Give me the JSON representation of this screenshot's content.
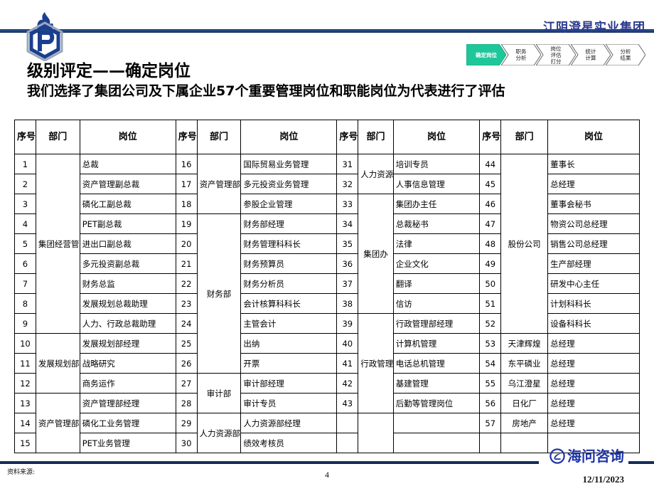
{
  "header": {
    "company_name": "江阴澄星实业集团",
    "logo_icon": "hexagon-flame-p-logo"
  },
  "process_steps": [
    {
      "label1": "确定岗位",
      "label2": "",
      "active": true
    },
    {
      "label1": "职务",
      "label2": "分析",
      "active": false
    },
    {
      "label1": "岗位",
      "label2": "评估",
      "label3": "打分",
      "active": false
    },
    {
      "label1": "统计",
      "label2": "计算",
      "active": false
    },
    {
      "label1": "分析",
      "label2": "结果",
      "active": false
    }
  ],
  "title": {
    "main": "级别评定——确定岗位",
    "sub": "我们选择了集团公司及下属企业57个重要管理岗位和职能岗位为代表进行了评估"
  },
  "table": {
    "headers": [
      "序号",
      "部门",
      "岗位",
      "序号",
      "部门",
      "岗位",
      "序号",
      "部门",
      "岗位",
      "序号",
      "部门",
      "岗位"
    ],
    "blocks": [
      {
        "departments": [
          {
            "name": "集团经营管理委员会",
            "rows": 9,
            "start": 0
          },
          {
            "name": "发展规划部",
            "rows": 3,
            "start": 9
          },
          {
            "name": "资产管理部",
            "rows": 3,
            "start": 12
          }
        ],
        "rows": [
          {
            "no": "1",
            "pos": "总裁"
          },
          {
            "no": "2",
            "pos": "资产管理副总裁"
          },
          {
            "no": "3",
            "pos": "磷化工副总裁"
          },
          {
            "no": "4",
            "pos": "PET副总裁"
          },
          {
            "no": "5",
            "pos": "进出口副总裁"
          },
          {
            "no": "6",
            "pos": "多元投资副总裁"
          },
          {
            "no": "7",
            "pos": "财务总监"
          },
          {
            "no": "8",
            "pos": "发展规划总裁助理"
          },
          {
            "no": "9",
            "pos": "人力、行政总裁助理"
          },
          {
            "no": "10",
            "pos": "发展规划部经理"
          },
          {
            "no": "11",
            "pos": "战略研究"
          },
          {
            "no": "12",
            "pos": "商务运作"
          },
          {
            "no": "13",
            "pos": "资产管理部经理"
          },
          {
            "no": "14",
            "pos": "磷化工业务管理"
          },
          {
            "no": "15",
            "pos": "PET业务管理"
          }
        ]
      },
      {
        "departments": [
          {
            "name": "资产管理部",
            "rows": 3,
            "start": 0
          },
          {
            "name": "财务部",
            "rows": 8,
            "start": 3
          },
          {
            "name": "审计部",
            "rows": 2,
            "start": 11
          },
          {
            "name": "人力资源部",
            "rows": 2,
            "start": 13
          }
        ],
        "rows": [
          {
            "no": "16",
            "pos": "国际贸易业务管理"
          },
          {
            "no": "17",
            "pos": "多元投资业务管理"
          },
          {
            "no": "18",
            "pos": "参股企业管理"
          },
          {
            "no": "19",
            "pos": "财务部经理"
          },
          {
            "no": "20",
            "pos": "财务管理科科长"
          },
          {
            "no": "21",
            "pos": "财务预算员"
          },
          {
            "no": "22",
            "pos": "财务分析员"
          },
          {
            "no": "23",
            "pos": "会计核算科科长"
          },
          {
            "no": "24",
            "pos": "主管会计"
          },
          {
            "no": "25",
            "pos": "出纳"
          },
          {
            "no": "26",
            "pos": "开票"
          },
          {
            "no": "27",
            "pos": "审计部经理"
          },
          {
            "no": "28",
            "pos": "审计专员"
          },
          {
            "no": "29",
            "pos": "人力资源部经理"
          },
          {
            "no": "30",
            "pos": "绩效考核员"
          }
        ]
      },
      {
        "departments": [
          {
            "name": "人力资源部",
            "rows": 2,
            "start": 0
          },
          {
            "name": "集团办",
            "rows": 6,
            "start": 2
          },
          {
            "name": "行政管理部",
            "rows": 5,
            "start": 8
          },
          {
            "name": "",
            "rows": 2,
            "start": 13
          }
        ],
        "rows": [
          {
            "no": "31",
            "pos": "培训专员"
          },
          {
            "no": "32",
            "pos": "人事信息管理"
          },
          {
            "no": "33",
            "pos": "集团办主任"
          },
          {
            "no": "34",
            "pos": "总裁秘书"
          },
          {
            "no": "35",
            "pos": "法律"
          },
          {
            "no": "36",
            "pos": "企业文化"
          },
          {
            "no": "37",
            "pos": "翻译"
          },
          {
            "no": "38",
            "pos": "信访"
          },
          {
            "no": "39",
            "pos": "行政管理部经理"
          },
          {
            "no": "40",
            "pos": "计算机管理"
          },
          {
            "no": "41",
            "pos": "电话总机管理"
          },
          {
            "no": "42",
            "pos": "基建管理"
          },
          {
            "no": "43",
            "pos": "后勤等管理岗位"
          },
          {
            "no": "",
            "pos": ""
          },
          {
            "no": "",
            "pos": ""
          }
        ]
      },
      {
        "departments": [
          {
            "name": "股份公司",
            "rows": 9,
            "start": 0
          },
          {
            "name": "天津辉煌",
            "rows": 1,
            "start": 9
          },
          {
            "name": "东平磷业",
            "rows": 1,
            "start": 10
          },
          {
            "name": "乌江澄星",
            "rows": 1,
            "start": 11
          },
          {
            "name": "日化厂",
            "rows": 1,
            "start": 12
          },
          {
            "name": "房地产",
            "rows": 1,
            "start": 13
          },
          {
            "name": "",
            "rows": 1,
            "start": 14
          }
        ],
        "rows": [
          {
            "no": "44",
            "pos": "董事长"
          },
          {
            "no": "45",
            "pos": "总经理"
          },
          {
            "no": "46",
            "pos": "董事会秘书"
          },
          {
            "no": "47",
            "pos": "物资公司总经理"
          },
          {
            "no": "48",
            "pos": "销售公司总经理"
          },
          {
            "no": "49",
            "pos": "生产部经理"
          },
          {
            "no": "50",
            "pos": "研发中心主任"
          },
          {
            "no": "51",
            "pos": "计划科科长"
          },
          {
            "no": "52",
            "pos": "设备科科长"
          },
          {
            "no": "53",
            "pos": "总经理"
          },
          {
            "no": "54",
            "pos": "总经理"
          },
          {
            "no": "55",
            "pos": "总经理"
          },
          {
            "no": "56",
            "pos": "总经理"
          },
          {
            "no": "57",
            "pos": "总经理"
          },
          {
            "no": "",
            "pos": ""
          }
        ]
      }
    ]
  },
  "footer": {
    "source_label": "资料来源:",
    "page_number": "4",
    "consultant_name": "海问咨询",
    "consultant_icon": "circle-swoosh-logo",
    "date": "12/11/2023"
  },
  "colors": {
    "brand_blue": "#2b3a8f",
    "rule_blue": "#1b3a6b",
    "active_step_green": "#1ec79a",
    "consultant_blue": "#1f35a8"
  }
}
